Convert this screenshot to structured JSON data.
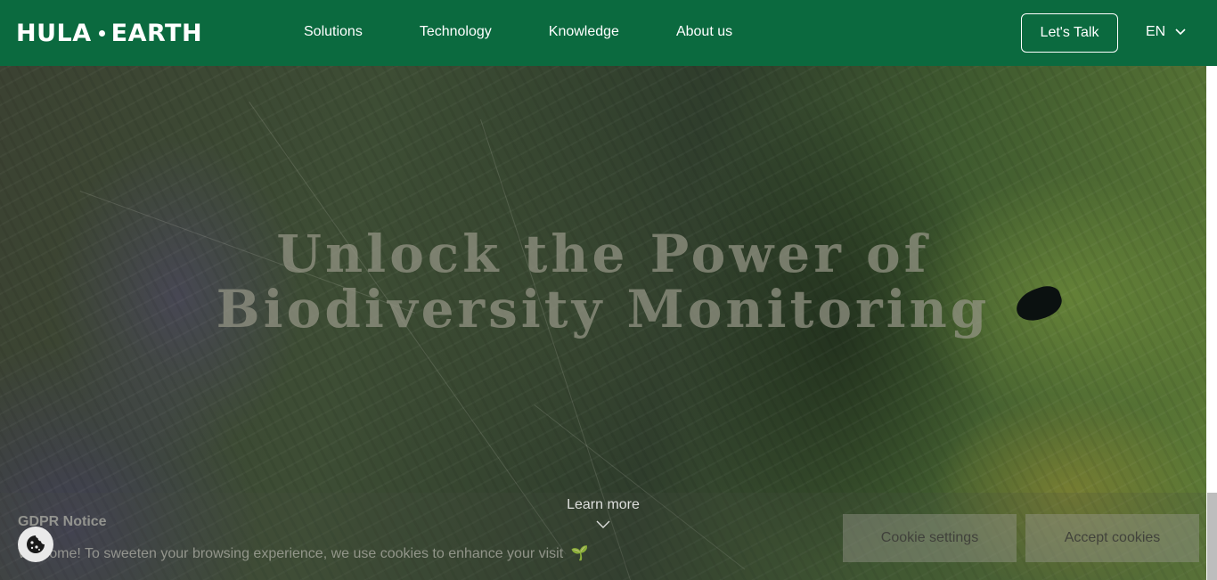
{
  "header": {
    "logo_left": "HULA",
    "logo_right": "EARTH",
    "nav": [
      {
        "label": "Solutions"
      },
      {
        "label": "Technology"
      },
      {
        "label": "Knowledge"
      },
      {
        "label": "About us"
      }
    ],
    "cta_label": "Let's Talk",
    "language": "EN",
    "colors": {
      "bar": "#0b6a3f",
      "text": "#ffffff"
    }
  },
  "hero": {
    "title_line1": "Unlock the Power of",
    "title_line2": "Biodiversity Monitoring",
    "learn_more": "Learn more",
    "background": "satellite-terrain-image"
  },
  "gdpr": {
    "title": "GDPR Notice",
    "message": "Welcome! To sweeten your browsing experience, we use cookies to enhance your visit",
    "emoji": "🌱",
    "settings_label": "Cookie settings",
    "accept_label": "Accept cookies"
  },
  "icons": {
    "language": "chevron-down-icon",
    "learn_more": "chevron-down-icon",
    "cookie": "cookie-icon"
  }
}
